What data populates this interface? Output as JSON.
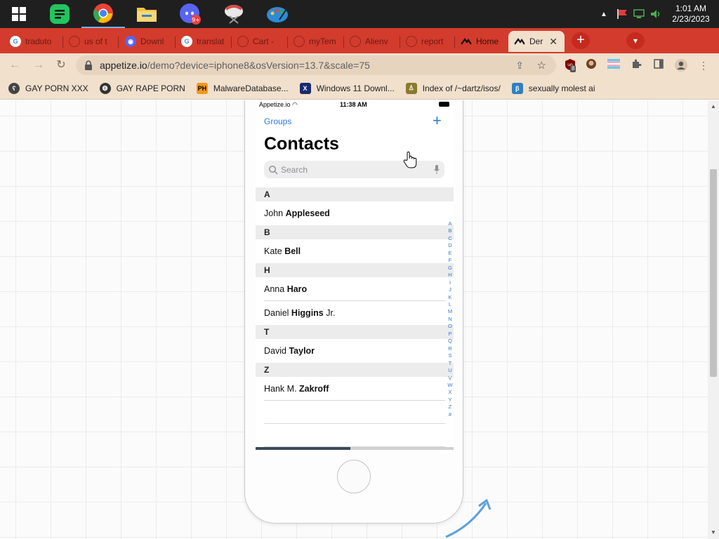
{
  "taskbar": {
    "apps": [
      {
        "name": "spotify-like-app",
        "color": "#1db954"
      },
      {
        "name": "chrome",
        "color": "#ea4335"
      },
      {
        "name": "file-explorer",
        "color": "#f4c542"
      },
      {
        "name": "discord",
        "color": "#5865f2",
        "badge": "9+"
      },
      {
        "name": "paint-app",
        "color": "#d84b4b"
      },
      {
        "name": "paint-palette",
        "color": "#2e8bd6"
      }
    ],
    "clock": {
      "time": "1:01 AM",
      "date": "2/23/2023"
    }
  },
  "tabs": [
    {
      "label": "traduto",
      "icon": "G",
      "icon_color": "#4285f4"
    },
    {
      "label": "us of t",
      "icon": "globe",
      "icon_color": "#8a2a20"
    },
    {
      "label": "Downl",
      "icon": "D",
      "icon_color": "#5865f2"
    },
    {
      "label": "translat",
      "icon": "G",
      "icon_color": "#4285f4"
    },
    {
      "label": "Cart -",
      "icon": "C",
      "icon_color": "#8a2a20"
    },
    {
      "label": "myTem",
      "icon": "m",
      "icon_color": "#8a2a20"
    },
    {
      "label": "Alienv",
      "icon": "A",
      "icon_color": "#8a2a20"
    },
    {
      "label": "report",
      "icon": "r",
      "icon_color": "#8a2a20"
    },
    {
      "label": "Home",
      "icon": "^",
      "icon_color": "#000000"
    },
    {
      "label": "Der",
      "icon": "^",
      "icon_color": "#000000",
      "active": true
    }
  ],
  "toolbar": {
    "url_host": "appetize.io",
    "url_path": "/demo?device=iphone8&osVersion=13.7&scale=75",
    "ext_badge": "8"
  },
  "bookmarks": [
    {
      "label": "GAY PORN XXX",
      "icon": "bear"
    },
    {
      "label": "GAY RAPE PORN",
      "icon": "globe"
    },
    {
      "label": "MalwareDatabase...",
      "icon": "PH"
    },
    {
      "label": "Windows 11 Downl...",
      "icon": "X"
    },
    {
      "label": "Index of /~dartz/isos/",
      "icon": "person"
    },
    {
      "label": "sexually molest ai",
      "icon": "ai"
    }
  ],
  "phone": {
    "status": {
      "carrier": "Appetize.io",
      "time": "11:38 AM"
    },
    "groups_label": "Groups",
    "add_label": "+",
    "title": "Contacts",
    "search_placeholder": "Search",
    "sections": [
      {
        "letter": "A",
        "rows": [
          {
            "first": "John",
            "last": "Appleseed",
            "suffix": ""
          }
        ]
      },
      {
        "letter": "B",
        "rows": [
          {
            "first": "Kate",
            "last": "Bell",
            "suffix": ""
          }
        ]
      },
      {
        "letter": "H",
        "rows": [
          {
            "first": "Anna",
            "last": "Haro",
            "suffix": ""
          },
          {
            "first": "Daniel",
            "last": "Higgins",
            "suffix": "Jr."
          }
        ]
      },
      {
        "letter": "T",
        "rows": [
          {
            "first": "David",
            "last": "Taylor",
            "suffix": ""
          }
        ]
      },
      {
        "letter": "Z",
        "rows": [
          {
            "first": "Hank M.",
            "last": "Zakroff",
            "suffix": ""
          }
        ]
      }
    ],
    "index_letters": [
      "A",
      "B",
      "C",
      "D",
      "E",
      "F",
      "G",
      "H",
      "I",
      "J",
      "K",
      "L",
      "M",
      "N",
      "O",
      "P",
      "Q",
      "R",
      "S",
      "T",
      "U",
      "V",
      "W",
      "X",
      "Y",
      "Z",
      "#"
    ],
    "scroll_progress": 0.48
  }
}
